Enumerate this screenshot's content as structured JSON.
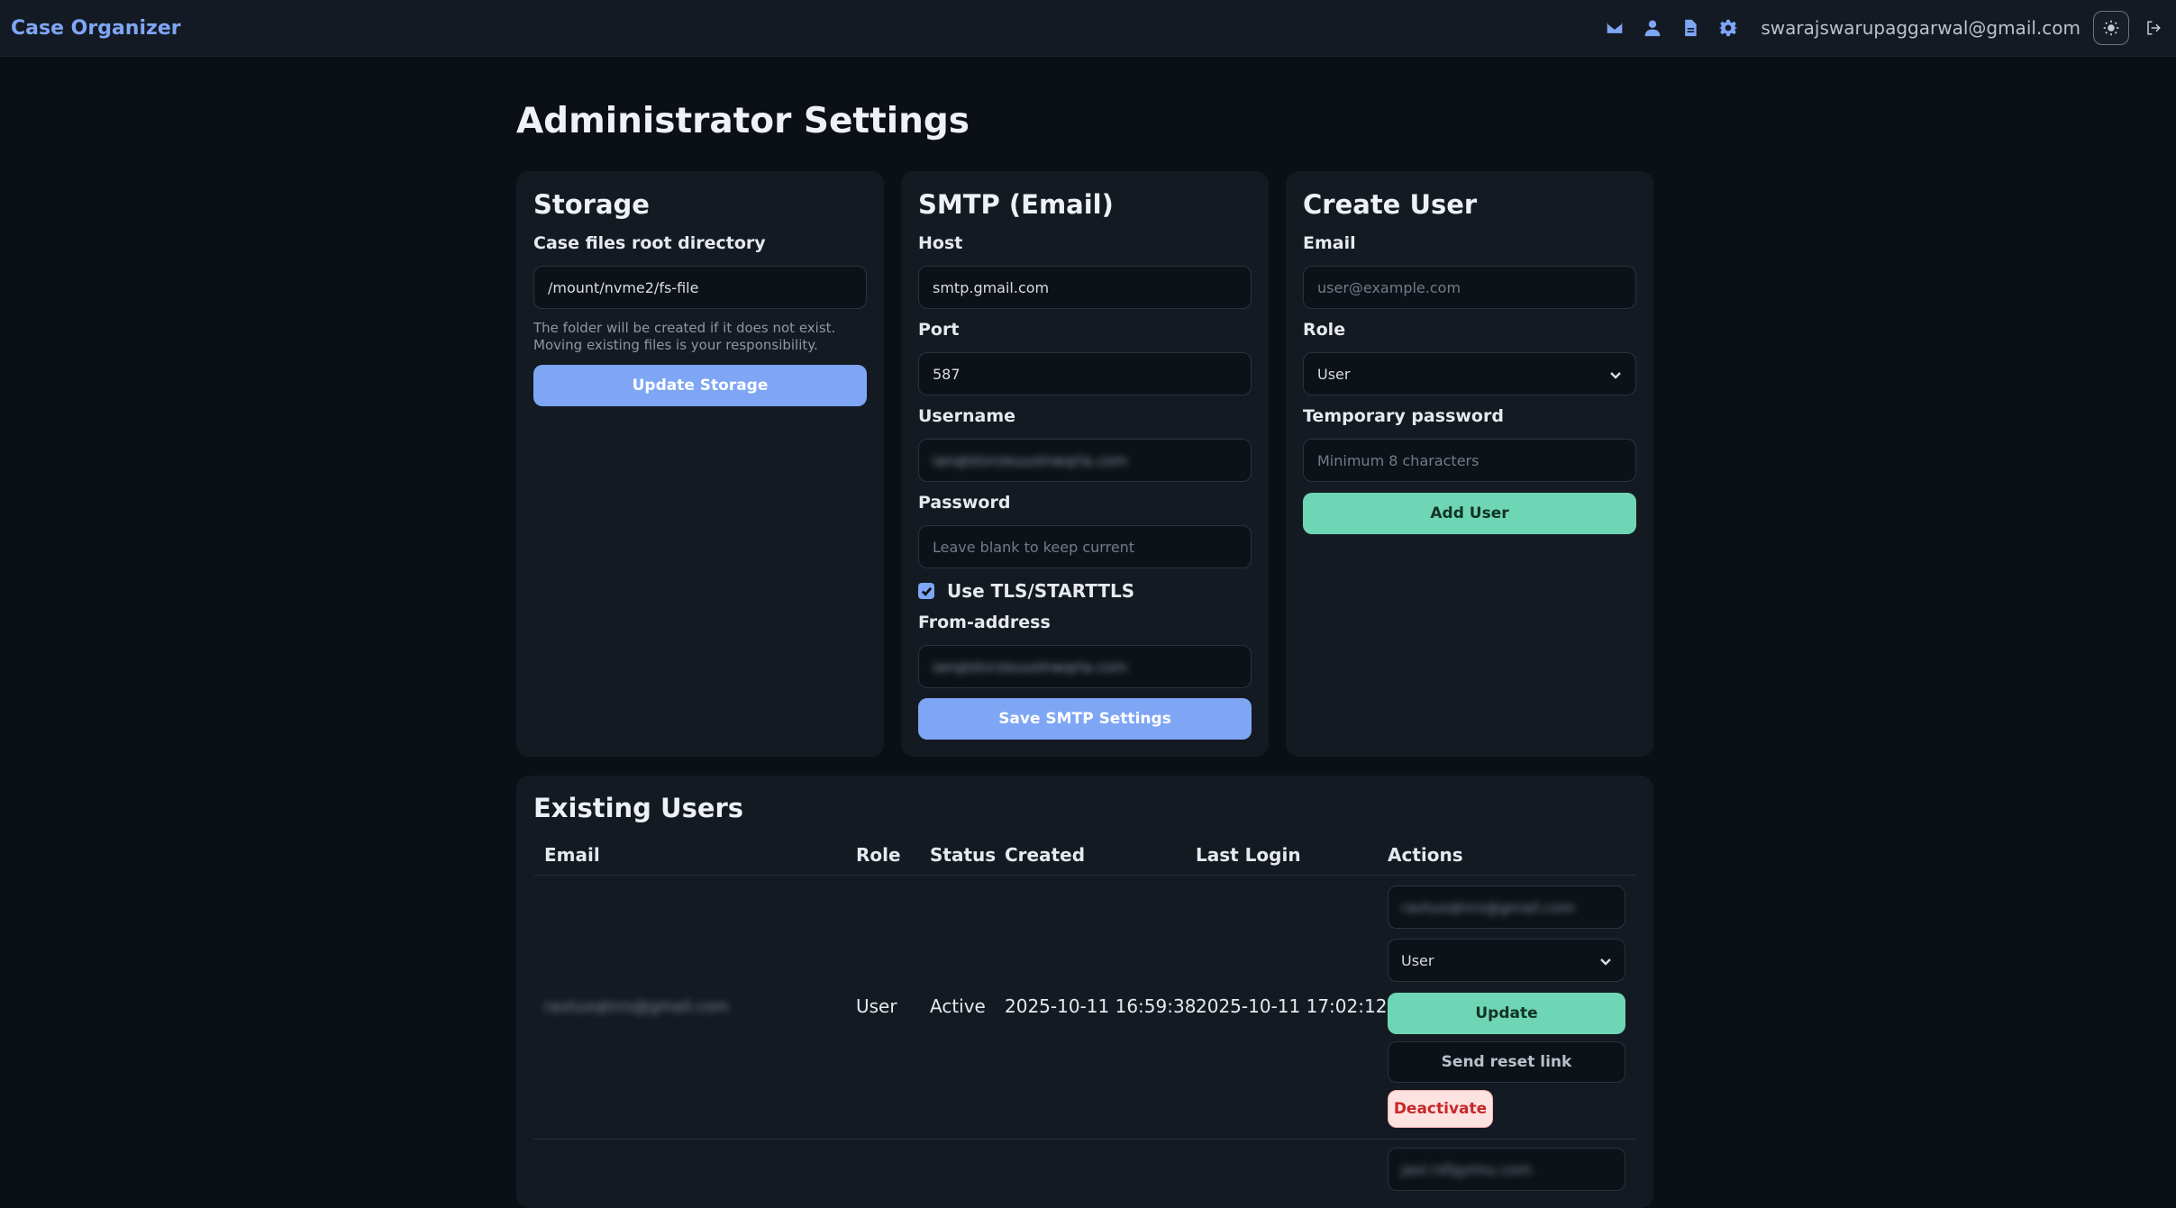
{
  "app": {
    "brand": "Case Organizer",
    "user_email": "swarajswarupaggarwal@gmail.com"
  },
  "nav_icons": [
    "mail-icon",
    "user-icon",
    "document-icon",
    "gear-icon"
  ],
  "page": {
    "title": "Administrator Settings"
  },
  "storage": {
    "title": "Storage",
    "dir_label": "Case files root directory",
    "dir_value": "/mount/nvme2/fs-file",
    "hint": "The folder will be created if it does not exist. Moving existing files is your responsibility.",
    "button": "Update Storage"
  },
  "smtp": {
    "title": "SMTP (Email)",
    "host_label": "Host",
    "host_value": "smtp.gmail.com",
    "port_label": "Port",
    "port_value": "587",
    "username_label": "Username",
    "username_value": "[blurred]",
    "password_label": "Password",
    "password_placeholder": "Leave blank to keep current",
    "tls_label": "Use TLS/STARTTLS",
    "tls_checked": true,
    "from_label": "From-address",
    "from_value": "[blurred]",
    "button": "Save SMTP Settings"
  },
  "create_user": {
    "title": "Create User",
    "email_label": "Email",
    "email_placeholder": "user@example.com",
    "role_label": "Role",
    "role_value": "User",
    "password_label": "Temporary password",
    "password_placeholder": "Minimum 8 characters",
    "button": "Add User"
  },
  "users": {
    "title": "Existing Users",
    "columns": [
      "Email",
      "Role",
      "Status",
      "Created",
      "Last Login",
      "Actions"
    ],
    "rows": [
      {
        "email": "[blurred]",
        "role": "User",
        "status": "Active",
        "created": "2025-10-11 16:59:38",
        "last_login": "2025-10-11 17:02:12",
        "action_email": "[blurred]",
        "action_role": "User",
        "update": "Update",
        "reset": "Send reset link",
        "deactivate": "Deactivate"
      },
      {
        "action_email": "[blurred]"
      }
    ]
  },
  "colors": {
    "accent": "#7ea6f5",
    "success": "#6fd6b5",
    "danger": "#c62828",
    "bg": "#0b1016",
    "card": "#141a22"
  }
}
